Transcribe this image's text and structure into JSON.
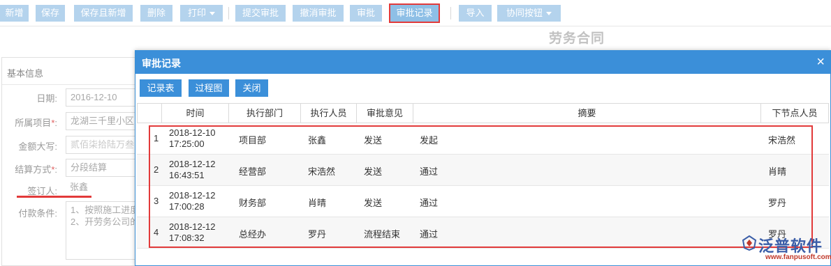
{
  "toolbar": {
    "buttons": [
      {
        "label": "新增"
      },
      {
        "label": "保存"
      },
      {
        "label": "保存且新增"
      },
      {
        "label": "删除"
      },
      {
        "label": "打印"
      },
      {
        "label": "提交审批"
      },
      {
        "label": "撤消审批"
      },
      {
        "label": "审批"
      },
      {
        "label": "审批记录"
      },
      {
        "label": "导入"
      },
      {
        "label": "协同按钮"
      }
    ]
  },
  "page_title": "劳务合同",
  "form": {
    "section_title": "基本信息",
    "fields": [
      {
        "label": "日期:",
        "value": "2016-12-10"
      },
      {
        "label": "所属项目",
        "required_mark": "*",
        "colon": ":",
        "value": "龙湖三千里小区"
      },
      {
        "label": "金额大写:",
        "value": "贰佰柒拾陆万叁"
      },
      {
        "label": "结算方式",
        "required_mark": "*",
        "colon": ":",
        "value": "分段结算"
      },
      {
        "label": "签订人:",
        "value": "张鑫"
      },
      {
        "label": "付款条件:",
        "value_lines": [
          "1、按照施工进度",
          "2、开劳务公司的"
        ]
      }
    ]
  },
  "modal": {
    "title": "审批记录",
    "close_glyph": "×",
    "buttons": [
      {
        "label": "记录表"
      },
      {
        "label": "过程图"
      },
      {
        "label": "关闭"
      }
    ],
    "table": {
      "columns": [
        "时间",
        "执行部门",
        "执行人员",
        "审批意见",
        "摘要",
        "下节点人员"
      ],
      "rows": [
        {
          "no": "1",
          "date": "2018-12-10",
          "time": "17:25:00",
          "dept": "项目部",
          "person": "张鑫",
          "opinion": "发送",
          "summary": "发起",
          "next": "宋浩然"
        },
        {
          "no": "2",
          "date": "2018-12-12",
          "time": "16:43:51",
          "dept": "经营部",
          "person": "宋浩然",
          "opinion": "发送",
          "summary": "通过",
          "next": "肖晴"
        },
        {
          "no": "3",
          "date": "2018-12-12",
          "time": "17:00:28",
          "dept": "财务部",
          "person": "肖晴",
          "opinion": "发送",
          "summary": "通过",
          "next": "罗丹"
        },
        {
          "no": "4",
          "date": "2018-12-12",
          "time": "17:08:32",
          "dept": "总经办",
          "person": "罗丹",
          "opinion": "流程结束",
          "summary": "通过",
          "next": "罗丹"
        }
      ]
    }
  },
  "watermark": {
    "text": "泛普软件",
    "url": "www.fanpusoft.com"
  },
  "colors": {
    "primary": "#3b8fd9",
    "toolbar_button": "#b4d3ed",
    "highlight_red": "#e23a3a"
  }
}
